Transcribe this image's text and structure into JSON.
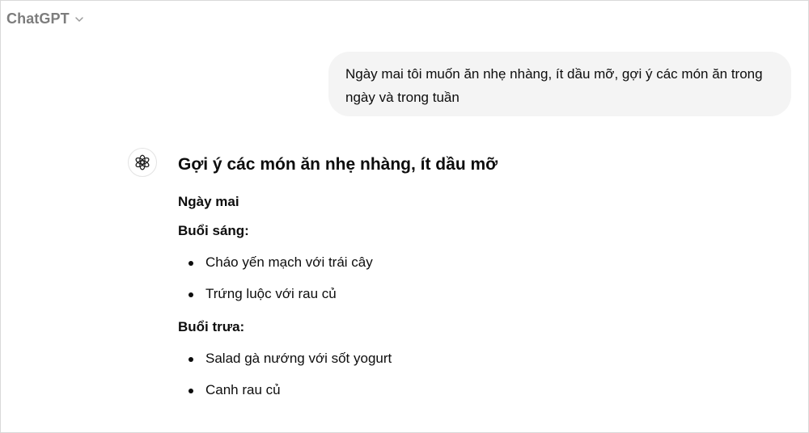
{
  "header": {
    "model_name": "ChatGPT",
    "chevron_icon": "chevron-down-icon"
  },
  "conversation": {
    "user_message": "Ngày mai tôi muốn ăn nhẹ nhàng, ít dầu mỡ, gợi ý các món ăn trong ngày và trong tuần",
    "assistant_icon": "openai-logo-icon",
    "response": {
      "heading": "Gợi ý các món ăn nhẹ nhàng, ít dầu mỡ",
      "day_title": "Ngày mai",
      "meals": [
        {
          "title": "Buổi sáng:",
          "items": [
            "Cháo yến mạch với trái cây",
            "Trứng luộc với rau củ"
          ]
        },
        {
          "title": "Buổi trưa:",
          "items": [
            "Salad gà nướng với sốt yogurt",
            "Canh rau củ"
          ]
        }
      ]
    }
  }
}
